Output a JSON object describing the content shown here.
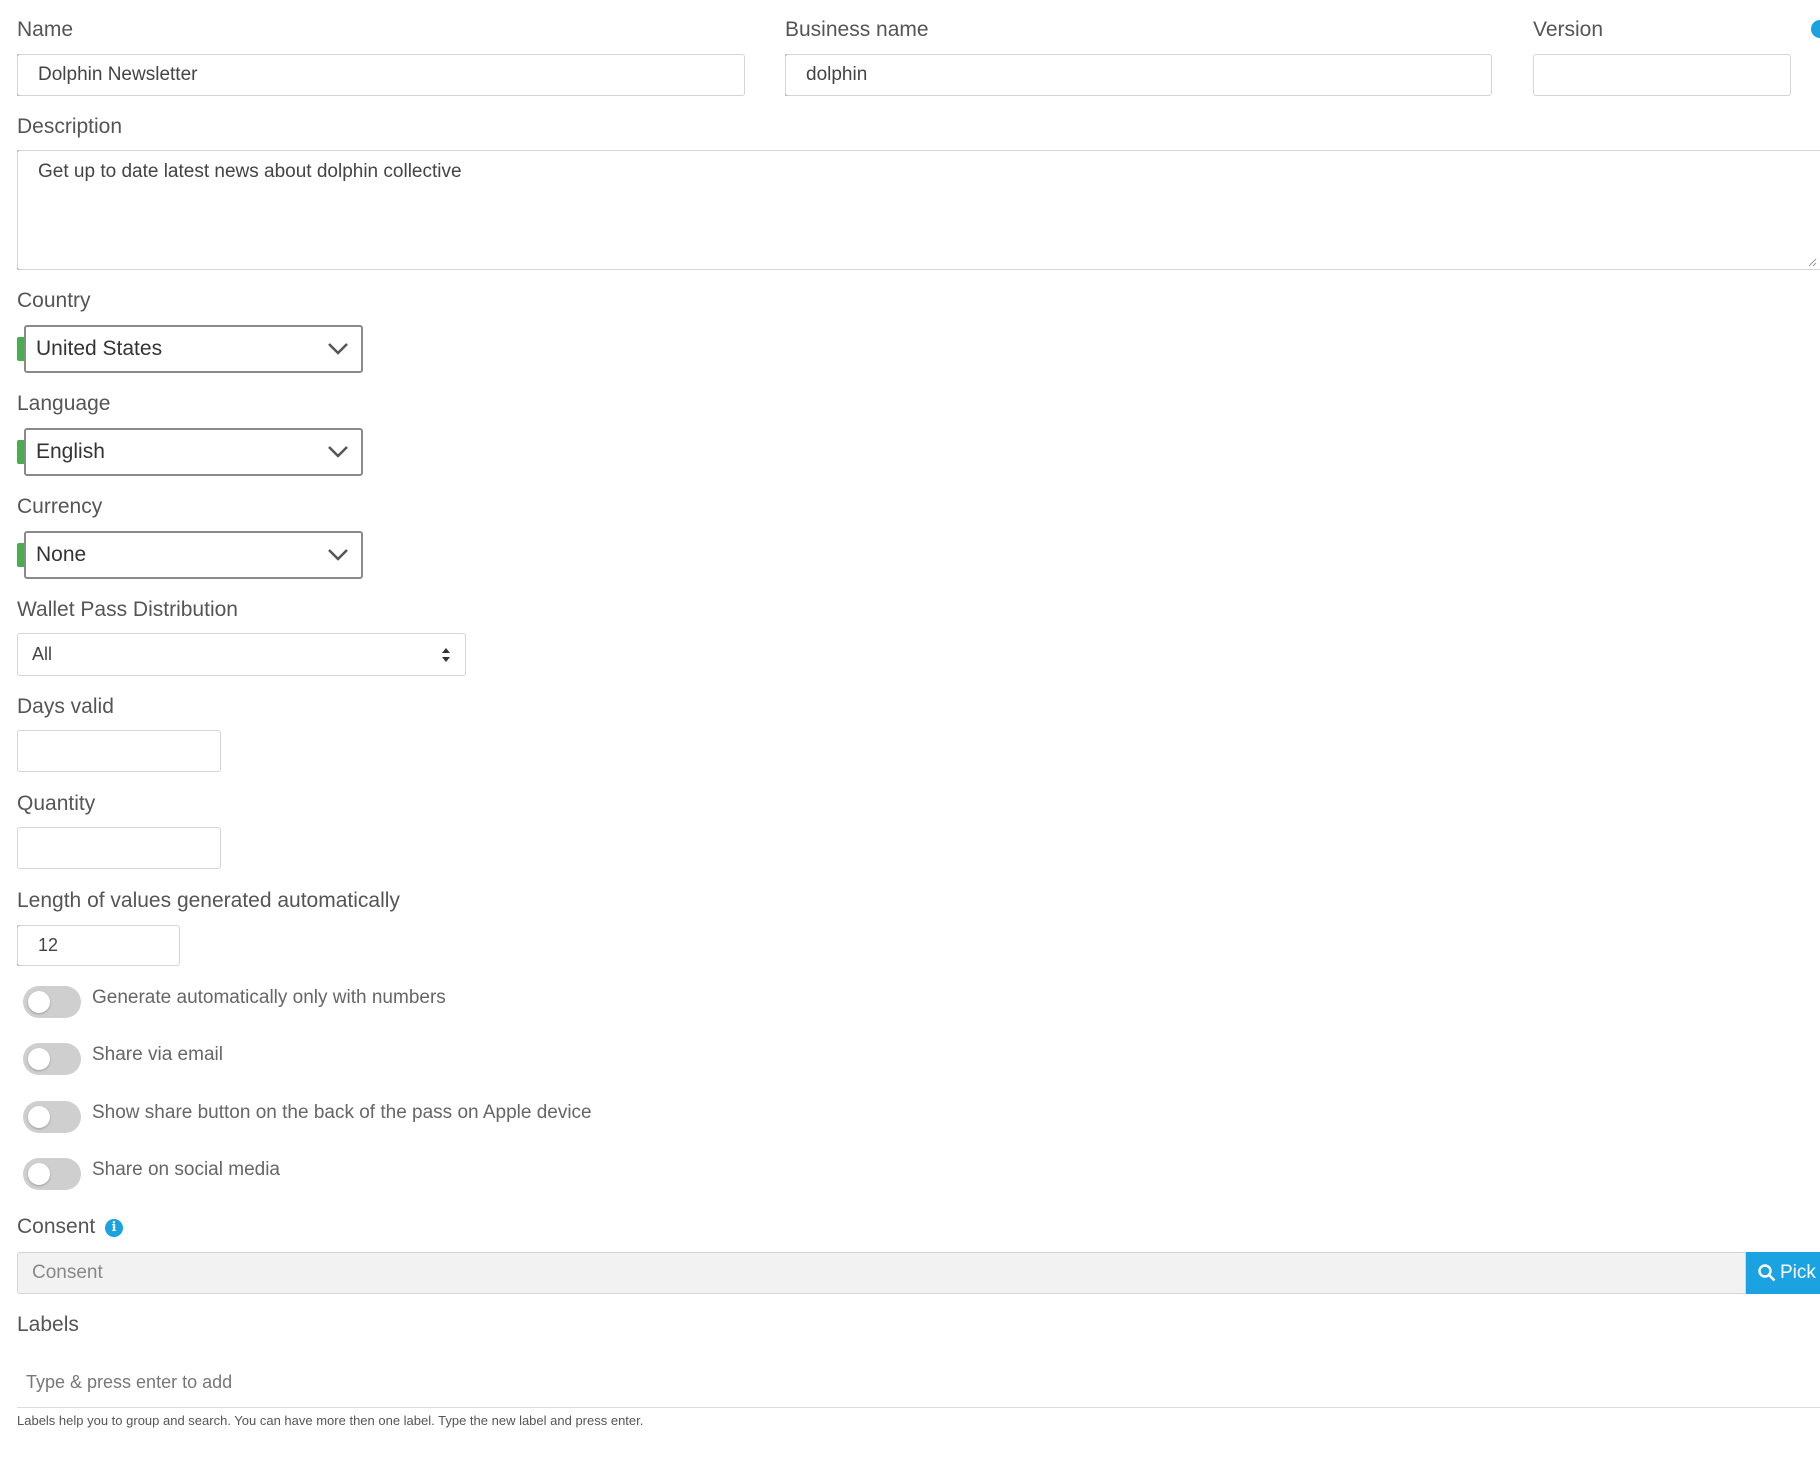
{
  "name": {
    "label": "Name",
    "value": "Dolphin Newsletter"
  },
  "business_name": {
    "label": "Business name",
    "value": "dolphin"
  },
  "version": {
    "label": "Version",
    "value": ""
  },
  "description": {
    "label": "Description",
    "value": "Get up to date latest news about dolphin collective"
  },
  "country": {
    "label": "Country",
    "value": "United States"
  },
  "language": {
    "label": "Language",
    "value": "English"
  },
  "currency": {
    "label": "Currency",
    "value": "None"
  },
  "wallet_pass_distribution": {
    "label": "Wallet Pass Distribution",
    "value": "All"
  },
  "days_valid": {
    "label": "Days valid",
    "value": ""
  },
  "quantity": {
    "label": "Quantity",
    "value": ""
  },
  "auto_length": {
    "label": "Length of values generated automatically",
    "value": "12"
  },
  "toggles": [
    {
      "label": "Generate automatically only with numbers",
      "on": false
    },
    {
      "label": "Share via email",
      "on": false
    },
    {
      "label": "Show share button on the back of the pass on Apple device",
      "on": false
    },
    {
      "label": "Share on social media",
      "on": false
    }
  ],
  "consent": {
    "label": "Consent",
    "placeholder": "Consent",
    "pick_label": "Pick"
  },
  "labels": {
    "label": "Labels",
    "placeholder": "Type & press enter to add",
    "help": "Labels help you to group and search. You can have more then one label. Type the new label and press enter."
  },
  "colors": {
    "valid": "#46b14c",
    "accent": "#1aa3e0",
    "toggle_off": "#cfcfcf"
  }
}
